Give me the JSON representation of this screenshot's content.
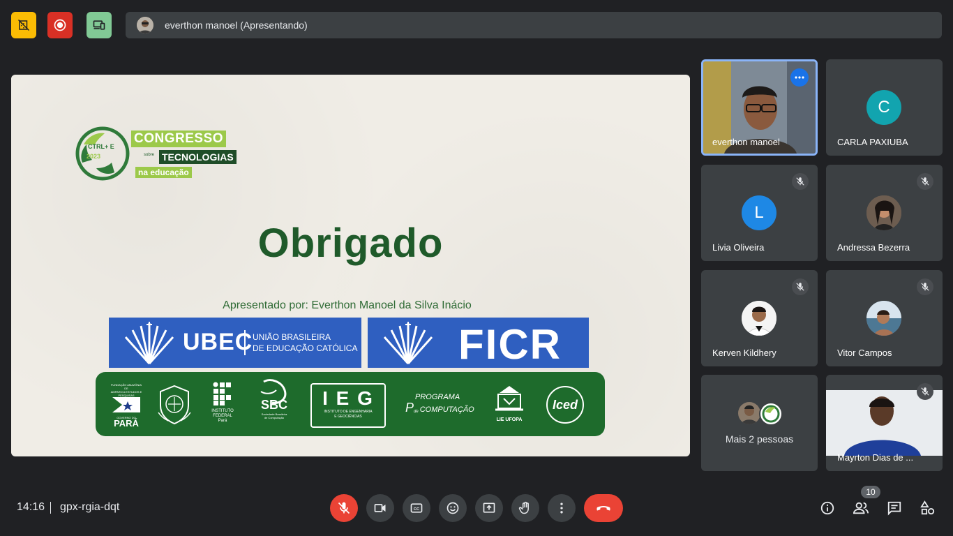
{
  "topbar": {
    "presenter_label": "everthon manoel (Apresentando)",
    "buttons": [
      {
        "name": "no-video-feed-icon",
        "color": "#fbbc04"
      },
      {
        "name": "record-icon",
        "color": "#d93025"
      },
      {
        "name": "companion-device-icon",
        "color": "#81c995"
      }
    ]
  },
  "slide": {
    "logo": {
      "ring_top": "CTRL+ E",
      "ring_year": "2023",
      "congresso": "CONGRESSO",
      "sobre": "sobre",
      "tecnologias": "TECNOLOGIAS",
      "educacao": "na educação"
    },
    "title": "Obrigado",
    "presented_by": "Apresentado por: Everthon Manoel da Silva Inácio",
    "ubec": {
      "acronym": "UBEC",
      "line1": "UNIÃO BRASILEIRA",
      "line2": "DE EDUCAÇÃO CATÓLICA"
    },
    "ficr": {
      "acronym": "FICR"
    },
    "partners": [
      {
        "name": "fapespa",
        "line1": "FUNDAÇÃO AMAZÔNIA DE",
        "line2": "AMPARO A ESTUDOS E",
        "line3": "PESQUISAS",
        "gov": "GOVERNO DO",
        "state": "PARÁ"
      },
      {
        "name": "uepa-crest"
      },
      {
        "name": "ifpa",
        "line1": "INSTITUTO",
        "line2": "FEDERAL",
        "line3": "Pará"
      },
      {
        "name": "sbc",
        "acronym": "SBC",
        "sub1": "Sociedade Brasileira",
        "sub2": "de Computação"
      },
      {
        "name": "ieg",
        "acronym": "I E G",
        "sub1": "INSTITUTO DE ENGENHARIA",
        "sub2": "E GEOCIÊNCIAS"
      },
      {
        "name": "programa-computacao",
        "line1": "PROGRAMA",
        "line2": "COMPUTAÇÃO",
        "prefix": "de"
      },
      {
        "name": "lie-ufopa",
        "label": "LIE UFOPA"
      },
      {
        "name": "iced",
        "label": "Iced"
      }
    ]
  },
  "participants": [
    {
      "name": "everthon manoel",
      "type": "video",
      "active": true
    },
    {
      "name": "CARLA PAXIUBA",
      "type": "initial",
      "initial": "C",
      "color": "#12a4af",
      "muted": false
    },
    {
      "name": "Livia Oliveira",
      "type": "initial",
      "initial": "L",
      "color": "#1e88e5",
      "muted": true
    },
    {
      "name": "Andressa Bezerra",
      "type": "photo",
      "muted": true
    },
    {
      "name": "Kerven Kildhery",
      "type": "photo",
      "muted": true
    },
    {
      "name": "Vitor Campos",
      "type": "photo",
      "muted": true
    },
    {
      "name": "Mais 2 pessoas",
      "type": "more"
    },
    {
      "name": "Mayrton Dias de ...",
      "type": "video",
      "muted": true
    }
  ],
  "bottombar": {
    "time": "14:16",
    "meeting_code": "gpx-rgia-dqt",
    "people_count": "10",
    "controls": [
      "mic-off-icon",
      "camera-icon",
      "captions-icon",
      "emoji-icon",
      "present-icon",
      "raise-hand-icon",
      "more-options-icon",
      "end-call-icon"
    ],
    "right": [
      "info-icon",
      "people-icon",
      "chat-icon",
      "activities-icon"
    ]
  }
}
